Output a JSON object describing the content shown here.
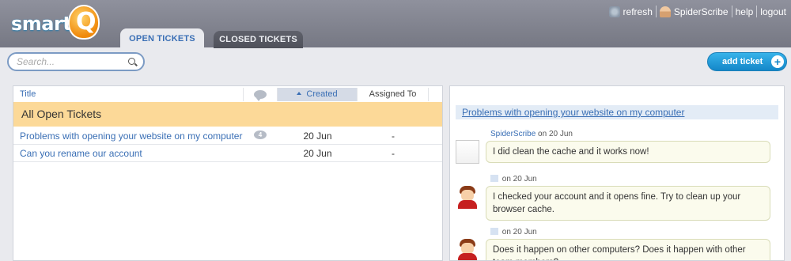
{
  "app": {
    "logo_text": "smart",
    "logo_letter": "Q"
  },
  "tabs": [
    {
      "label": "OPEN TICKETS",
      "active": true
    },
    {
      "label": "CLOSED TICKETS",
      "active": false
    }
  ],
  "toplinks": {
    "refresh": "refresh",
    "user": "SpiderScribe",
    "help": "help",
    "logout": "logout"
  },
  "search": {
    "placeholder": "Search..."
  },
  "add_ticket": {
    "label": "add ticket"
  },
  "table": {
    "columns": {
      "title": "Title",
      "created": "Created",
      "assigned": "Assigned To"
    },
    "group": "All Open Tickets",
    "rows": [
      {
        "title": "Problems with opening your website on my computer",
        "comments": "4",
        "created": "20 Jun",
        "assigned": "-"
      },
      {
        "title": "Can you rename our account",
        "comments": "",
        "created": "20 Jun",
        "assigned": "-"
      }
    ]
  },
  "conversation": {
    "title": "Problems with opening your website on my computer",
    "messages": [
      {
        "author": "SpiderScribe",
        "date": "on 20 Jun",
        "text": "I did clean the cache and it works now!"
      },
      {
        "author": "",
        "date": "on 20 Jun",
        "text": "I checked your account and it opens fine. Try to clean up your browser cache."
      },
      {
        "author": "",
        "date": "on 20 Jun",
        "text": "Does it happen on other computers? Does it happen with other team members?"
      }
    ]
  },
  "colors": {
    "accent_blue": "#3a6fb5",
    "group_highlight": "#fcd998",
    "add_button": "#1487c9"
  }
}
